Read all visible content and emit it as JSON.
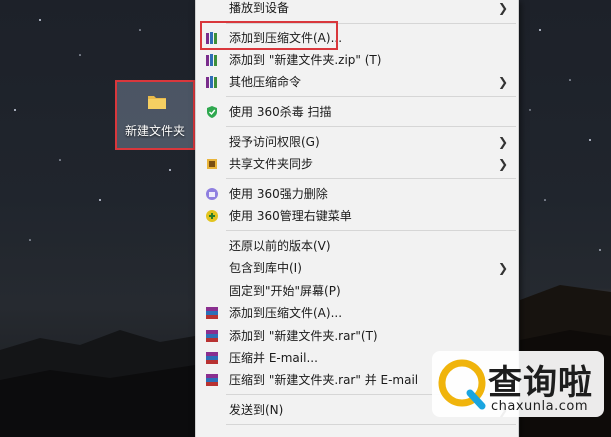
{
  "desktop": {
    "folder_label": "新建文件夹"
  },
  "context_menu": {
    "items": [
      {
        "label": "播放到设备",
        "icon": "none",
        "has_submenu": true
      },
      {
        "label": "添加到压缩文件(A)...",
        "icon": "winrar-books-icon",
        "has_submenu": false,
        "highlighted": true
      },
      {
        "label": "添加到 \"新建文件夹.zip\" (T)",
        "icon": "winrar-books-icon",
        "has_submenu": false
      },
      {
        "label": "其他压缩命令",
        "icon": "winrar-books-icon",
        "has_submenu": true
      },
      {
        "label": "使用 360杀毒 扫描",
        "icon": "360-antivirus-shield-icon",
        "has_submenu": false
      },
      {
        "label": "授予访问权限(G)",
        "icon": "none",
        "has_submenu": true
      },
      {
        "label": "共享文件夹同步",
        "icon": "sync-folder-icon",
        "has_submenu": true
      },
      {
        "label": "使用 360强力删除",
        "icon": "360-delete-icon",
        "has_submenu": false
      },
      {
        "label": "使用 360管理右键菜单",
        "icon": "360-manage-icon",
        "has_submenu": false
      },
      {
        "label": "还原以前的版本(V)",
        "icon": "none",
        "has_submenu": false
      },
      {
        "label": "包含到库中(I)",
        "icon": "none",
        "has_submenu": true
      },
      {
        "label": "固定到\"开始\"屏幕(P)",
        "icon": "none",
        "has_submenu": false
      },
      {
        "label": "添加到压缩文件(A)...",
        "icon": "winrar-stack-icon",
        "has_submenu": false
      },
      {
        "label": "添加到 \"新建文件夹.rar\"(T)",
        "icon": "winrar-stack-icon",
        "has_submenu": false
      },
      {
        "label": "压缩并 E-mail...",
        "icon": "winrar-stack-icon",
        "has_submenu": false
      },
      {
        "label": "压缩到 \"新建文件夹.rar\" 并 E-mail",
        "icon": "winrar-stack-icon",
        "has_submenu": false
      },
      {
        "label": "发送到(N)",
        "icon": "none",
        "has_submenu": true
      }
    ]
  },
  "watermark": {
    "title": "查询啦",
    "domain": "chaxunla.com"
  },
  "colors": {
    "highlight_border": "#d9373c",
    "menu_background": "#f2f2f2"
  }
}
